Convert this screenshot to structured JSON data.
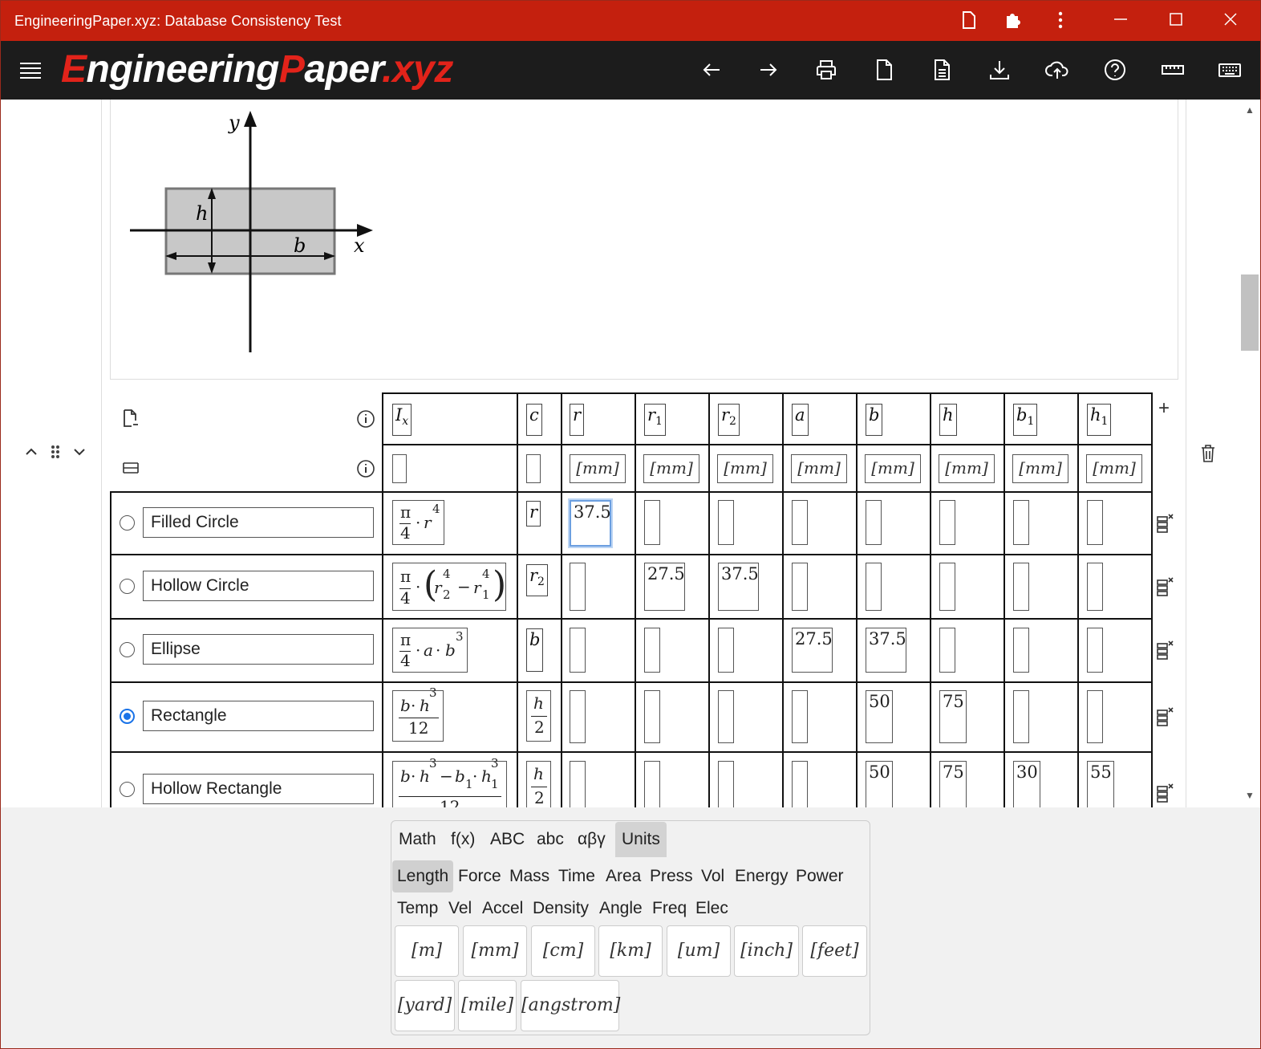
{
  "window": {
    "title": "EngineeringPaper.xyz: Database Consistency Test"
  },
  "header": {
    "logo_letter1": "E",
    "logo_part1": "ngineering",
    "logo_letter2": "P",
    "logo_part2": "aper",
    "logo_suffix": ".xyz"
  },
  "diagram": {
    "label_y": "y",
    "label_x": "x",
    "label_h": "h",
    "label_b": "b"
  },
  "table": {
    "variables": [
      "I",
      "c",
      "r",
      "r",
      "r",
      "a",
      "b",
      "h",
      "b",
      "h"
    ],
    "variable_subscripts": [
      "x",
      "",
      "",
      "1",
      "2",
      "",
      "",
      "",
      "1",
      "1"
    ],
    "units": [
      "",
      "",
      "[mm]",
      "[mm]",
      "[mm]",
      "[mm]",
      "[mm]",
      "[mm]",
      "[mm]",
      "[mm]"
    ],
    "rows": [
      {
        "name": "Filled Circle",
        "selected": false,
        "c": "r",
        "c_sub": "",
        "values": [
          "37.5",
          "",
          "",
          "",
          "",
          "",
          "",
          ""
        ]
      },
      {
        "name": "Hollow Circle",
        "selected": false,
        "c": "r",
        "c_sub": "2",
        "values": [
          "",
          "27.5",
          "37.5",
          "",
          "",
          "",
          "",
          ""
        ]
      },
      {
        "name": "Ellipse",
        "selected": false,
        "c": "b",
        "c_sub": "",
        "values": [
          "",
          "",
          "",
          "27.5",
          "37.5",
          "",
          "",
          ""
        ]
      },
      {
        "name": "Rectangle",
        "selected": true,
        "c": "h/2",
        "c_sub": "",
        "values": [
          "",
          "",
          "",
          "",
          "50",
          "75",
          "",
          ""
        ]
      },
      {
        "name": "Hollow Rectangle",
        "selected": false,
        "c": "h/2",
        "c_sub": "",
        "values": [
          "",
          "",
          "",
          "",
          "50",
          "75",
          "30",
          "55"
        ]
      }
    ],
    "formulas": {
      "pi": "π",
      "four": "4",
      "twelve": "12",
      "two": "2",
      "dot": "·",
      "minus": "−",
      "r": "r",
      "a": "a",
      "b": "b",
      "h": "h",
      "exp4": "4",
      "exp3": "3",
      "sub1": "1",
      "sub2": "2"
    },
    "add_column_glyph": "+"
  },
  "keyboard": {
    "tabs": [
      "Math",
      "f(x)",
      "ABC",
      "abc",
      "αβγ",
      "Units"
    ],
    "selected_tab": "Units",
    "subtabs_row1": [
      "Length",
      "Force",
      "Mass",
      "Time",
      "Area",
      "Press",
      "Vol",
      "Energy",
      "Power"
    ],
    "subtabs_row2": [
      "Temp",
      "Vel",
      "Accel",
      "Density",
      "Angle",
      "Freq",
      "Elec"
    ],
    "selected_subtab": "Length",
    "unit_keys_row1": [
      "[m]",
      "[mm]",
      "[cm]",
      "[km]",
      "[um]",
      "[inch]",
      "[feet]"
    ],
    "unit_keys_row2": [
      "[yard]",
      "[mile]",
      "[angstrom]"
    ]
  }
}
